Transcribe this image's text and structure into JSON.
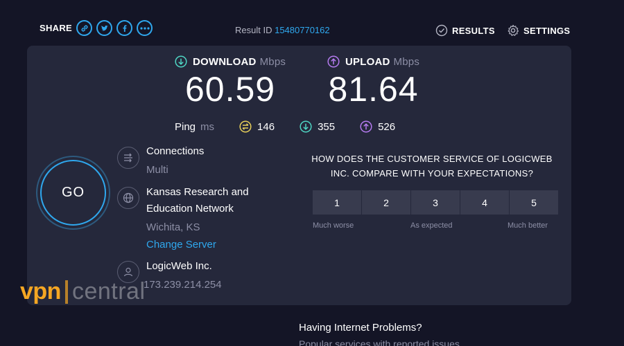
{
  "header": {
    "share_label": "SHARE",
    "share_icons": [
      "link-icon",
      "twitter-icon",
      "facebook-icon",
      "more-icon"
    ],
    "result_id_label": "Result ID",
    "result_id_value": "15480770162",
    "results_label": "RESULTS",
    "settings_label": "SETTINGS"
  },
  "speeds": {
    "download": {
      "label": "DOWNLOAD",
      "unit": "Mbps",
      "value": "60.59",
      "icon": "download-arrow-icon",
      "color": "#4fd6c4"
    },
    "upload": {
      "label": "UPLOAD",
      "unit": "Mbps",
      "value": "81.64",
      "icon": "upload-arrow-icon",
      "color": "#b57bf0"
    }
  },
  "ping": {
    "label": "Ping",
    "unit": "ms",
    "idle": {
      "value": "146",
      "icon": "ping-idle-icon",
      "color": "#e8d05a"
    },
    "download": {
      "value": "355",
      "icon": "ping-download-icon",
      "color": "#4fd6c4"
    },
    "upload": {
      "value": "526",
      "icon": "ping-upload-icon",
      "color": "#b57bf0"
    }
  },
  "go_button": {
    "label": "GO"
  },
  "connections": {
    "title": "Connections",
    "value": "Multi",
    "icon": "connections-icon"
  },
  "server": {
    "name_line1": "Kansas Research and",
    "name_line2": "Education Network",
    "location": "Wichita, KS",
    "change_label": "Change Server",
    "icon": "globe-icon"
  },
  "provider": {
    "name": "LogicWeb Inc.",
    "ip": "173.239.214.254",
    "icon": "user-icon"
  },
  "survey": {
    "question_line1": "HOW DOES THE CUSTOMER SERVICE OF LOGICWEB",
    "question_line2": "INC. COMPARE WITH YOUR EXPECTATIONS?",
    "ratings": [
      "1",
      "2",
      "3",
      "4",
      "5"
    ],
    "low_label": "Much worse",
    "mid_label": "As expected",
    "high_label": "Much better"
  },
  "watermark": {
    "brand_left": "vpn",
    "brand_right": "central",
    "color": "#f5a623"
  },
  "footer": {
    "title": "Having Internet Problems?",
    "subtitle": "Popular services with reported issues"
  },
  "colors": {
    "background": "#141526",
    "panel": "#25283b",
    "accent": "#2fa8ee"
  }
}
